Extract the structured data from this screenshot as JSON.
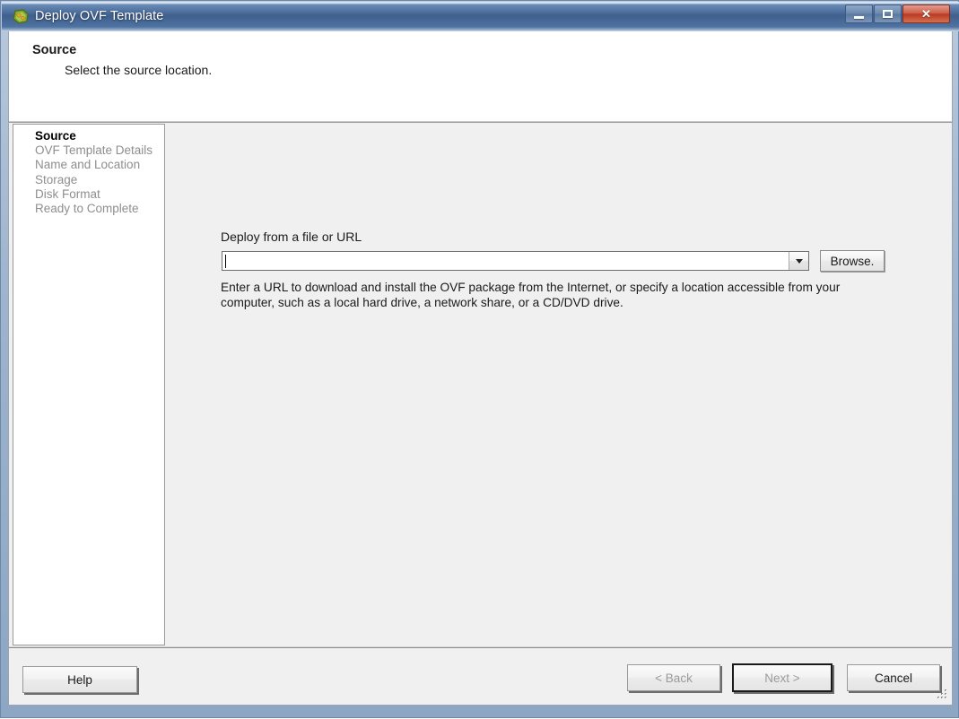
{
  "window": {
    "title": "Deploy OVF Template",
    "icon": "ovf-template-icon",
    "controls": {
      "minimize": "minimize-icon",
      "maximize": "maximize-icon",
      "close": "close-icon"
    },
    "colors": {
      "titlebar": "#456694",
      "close_button": "#b83b24",
      "client_background": "#f0f0f0",
      "panel_background": "#ffffff",
      "active_step_text": "#000000",
      "inactive_step_text": "#8e8e8e"
    }
  },
  "header": {
    "title": "Source",
    "subtitle": "Select the source location."
  },
  "sidebar": {
    "items": [
      {
        "label": "Source",
        "active": true
      },
      {
        "label": "OVF Template Details",
        "active": false
      },
      {
        "label": "Name and Location",
        "active": false
      },
      {
        "label": "Storage",
        "active": false
      },
      {
        "label": "Disk Format",
        "active": false
      },
      {
        "label": "Ready to Complete",
        "active": false
      }
    ]
  },
  "main": {
    "field_label": "Deploy from a file or URL",
    "combo": {
      "value": "",
      "placeholder": "",
      "dropdown_icon": "chevron-down-icon"
    },
    "browse_label": "Browse.",
    "description": "Enter a URL to download and install the OVF package from the Internet, or specify a location accessible from your computer, such as a local hard drive, a network share, or a CD/DVD drive."
  },
  "footer": {
    "help_label": "Help",
    "back_label": "< Back",
    "next_label": "Next >",
    "cancel_label": "Cancel",
    "back_enabled": false,
    "next_enabled": false,
    "next_is_default": true,
    "cancel_enabled": true,
    "resize_grip": "resize-grip-icon"
  }
}
